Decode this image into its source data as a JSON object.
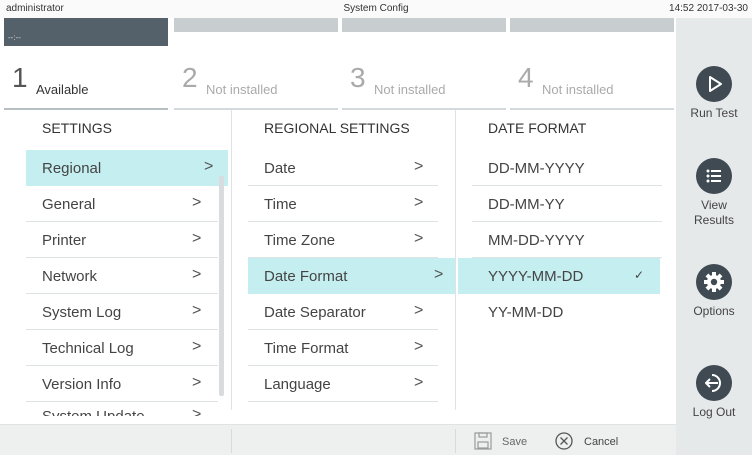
{
  "topbar": {
    "user": "administrator",
    "title": "System Config",
    "clock": "14:52 2017-03-30"
  },
  "bays": [
    {
      "number": "1",
      "status": "Available",
      "cap_text": "--:--"
    },
    {
      "number": "2",
      "status": "Not installed"
    },
    {
      "number": "3",
      "status": "Not installed"
    },
    {
      "number": "4",
      "status": "Not installed"
    }
  ],
  "sidebar": {
    "run_test": {
      "label": "Run Test",
      "icon": "play-icon"
    },
    "view_results": {
      "label": "View Results",
      "icon": "list-icon"
    },
    "options": {
      "label": "Options",
      "icon": "gear-icon"
    },
    "log_out": {
      "label": "Log Out",
      "icon": "logout-icon"
    }
  },
  "settings": {
    "header": "SETTINGS",
    "items": [
      "Regional",
      "General",
      "Printer",
      "Network",
      "System Log",
      "Technical Log",
      "Version Info",
      "System Update"
    ],
    "selected": "Regional"
  },
  "regional": {
    "header": "REGIONAL SETTINGS",
    "items": [
      "Date",
      "Time",
      "Time Zone",
      "Date Format",
      "Date Separator",
      "Time Format",
      "Language"
    ],
    "selected": "Date Format"
  },
  "date_format": {
    "header": "DATE FORMAT",
    "options": [
      "DD-MM-YYYY",
      "DD-MM-YY",
      "MM-DD-YYYY",
      "YYYY-MM-DD",
      "YY-MM-DD"
    ],
    "selected": "YYYY-MM-DD"
  },
  "bottombar": {
    "save_label": "Save",
    "cancel_label": "Cancel"
  },
  "colors": {
    "selected_row": "#c5eef1",
    "sidebar_icon": "#3f4a52",
    "bay_active": "#55616a"
  }
}
